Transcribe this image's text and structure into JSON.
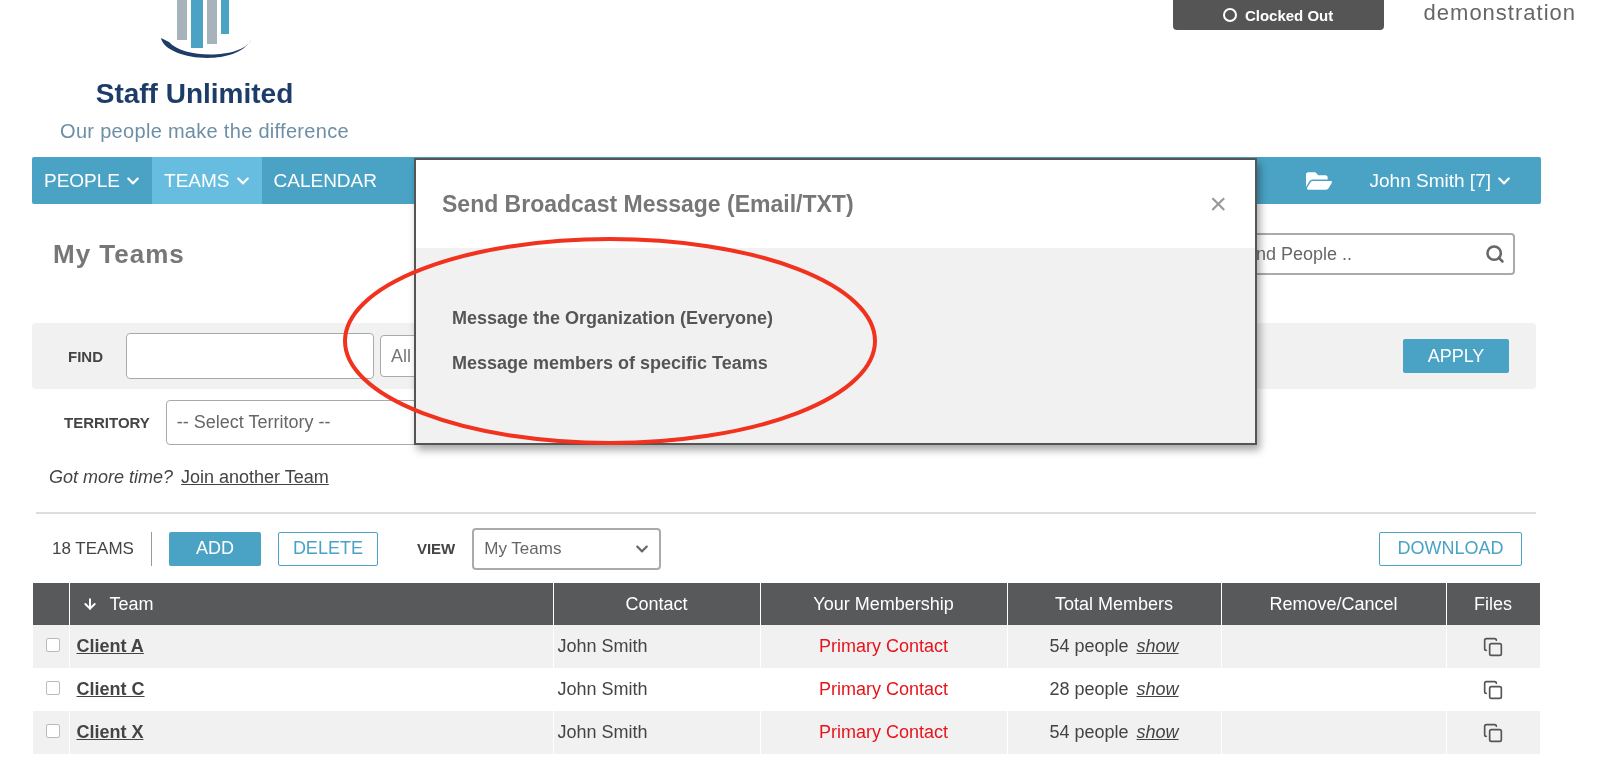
{
  "header": {
    "brand": "Staff Unlimited",
    "tagline": "Our people make the difference",
    "clock_button": "Clocked Out",
    "account": "demonstration"
  },
  "nav": {
    "items": [
      {
        "label": "PEOPLE",
        "selected": false,
        "has_menu": true
      },
      {
        "label": "TEAMS",
        "selected": true,
        "has_menu": true
      },
      {
        "label": "CALENDAR",
        "selected": false,
        "has_menu": false
      }
    ],
    "user": "John Smith [7]"
  },
  "page_title": "My Teams",
  "search": {
    "placeholder": "nd People .."
  },
  "filters": {
    "find_label": "FIND",
    "select_value": "All",
    "apply": "APPLY",
    "territory_label": "TERRITORY",
    "territory_placeholder": "-- Select Territory --"
  },
  "join": {
    "prompt": "Got more time?",
    "link": "Join another Team"
  },
  "toolbar": {
    "count": "18 TEAMS",
    "add": "ADD",
    "delete": "DELETE",
    "view_label": "VIEW",
    "view_value": "My Teams",
    "download": "DOWNLOAD"
  },
  "table": {
    "columns": [
      {
        "label": "Team",
        "sorted": true
      },
      {
        "label": "Contact",
        "sorted": false
      },
      {
        "label": "Your Membership",
        "sorted": false
      },
      {
        "label": "Total Members",
        "sorted": false
      },
      {
        "label": "Remove/Cancel",
        "sorted": false
      },
      {
        "label": "Files",
        "sorted": false
      }
    ],
    "rows": [
      {
        "checked": false,
        "team": "Client A",
        "contact": "John Smith",
        "membership": "Primary Contact",
        "members": "54 people",
        "members_link": "show"
      },
      {
        "checked": false,
        "team": "Client C",
        "contact": "John Smith",
        "membership": "Primary Contact",
        "members": "28 people",
        "members_link": "show"
      },
      {
        "checked": false,
        "team": "Client X",
        "contact": "John Smith",
        "membership": "Primary Contact",
        "members": "54 people",
        "members_link": "show"
      }
    ]
  },
  "modal": {
    "title": "Send Broadcast Message (Email/TXT)",
    "close": "×",
    "options": [
      "Message the Organization (Everyone)",
      "Message members of specific Teams"
    ]
  }
}
